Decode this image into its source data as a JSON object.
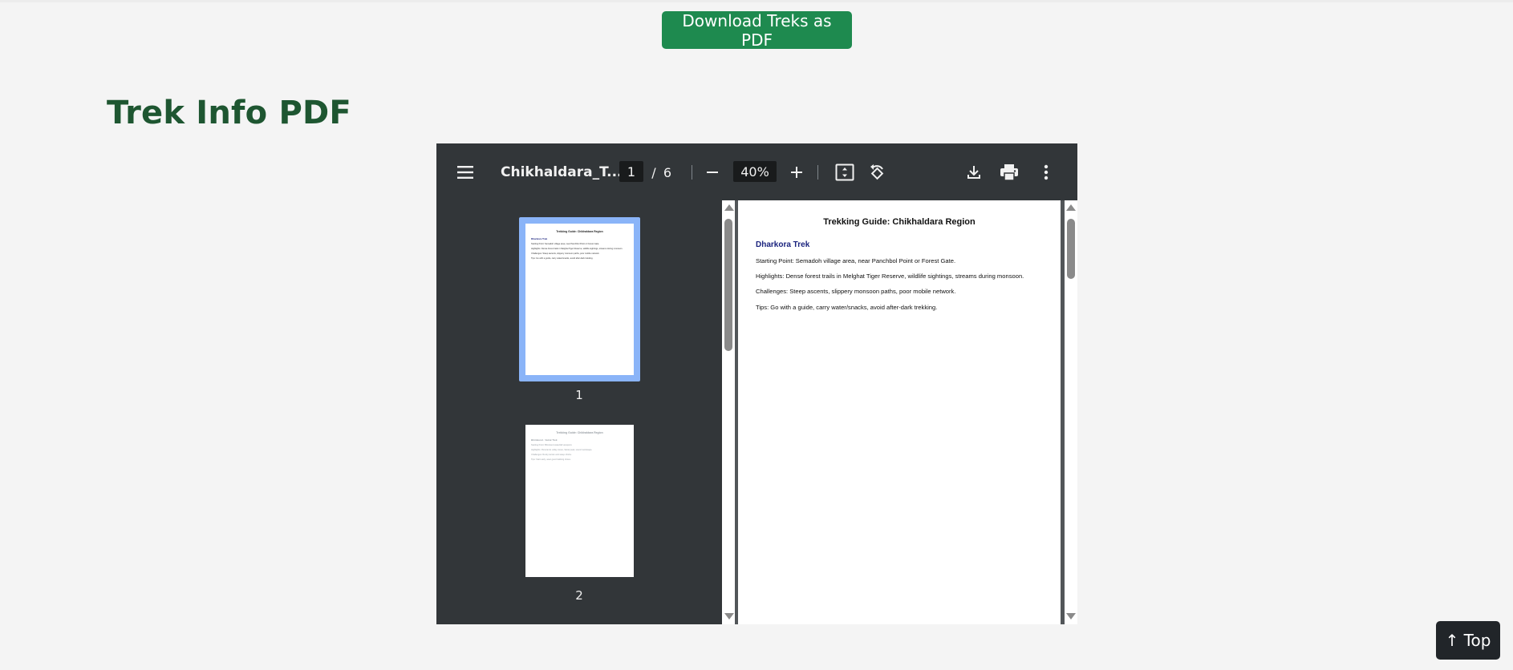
{
  "download_button": {
    "label": "Download Treks as PDF",
    "color": "#1e8a4f"
  },
  "section": {
    "title": "Trek Info PDF",
    "title_color": "#1e5631"
  },
  "pdf_viewer": {
    "toolbar": {
      "document_title": "Chikhaldara_T...",
      "current_page": "1",
      "page_separator": "/",
      "total_pages": "6",
      "zoom": "40%",
      "icons": [
        "menu-icon",
        "zoom-out-icon",
        "zoom-in-icon",
        "fit-to-page-icon",
        "rotate-icon",
        "download-icon",
        "print-icon",
        "more-options-icon"
      ]
    },
    "thumbnails": [
      {
        "number": "1",
        "selected": true,
        "title": "Trekking Guide: Chikhaldara Region",
        "heading": "Dharkora Trek",
        "lines": [
          "Starting Point: Semadoh village area, near Panchbol Point or Forest Gate.",
          "Highlights: Dense forest trails in Melghat Tiger Reserve, wildlife sightings, streams during monsoon.",
          "Challenges: Steep ascents, slippery monsoon paths, poor mobile network.",
          "Tips: Go with a guide, carry water/snacks, avoid after-dark trekking."
        ]
      },
      {
        "number": "2",
        "selected": false,
        "title": "Trekking Guide: Chikhaldara Region",
        "heading": "Bhimkund - Vairat Trek",
        "lines": [
          "Starting Point: Bhimkund waterfall viewpoint.",
          "Highlights: Panoramic valley views, Vairat peak, scenic landscape.",
          "Challenges: Rocky terrain and steep climbs.",
          "Tips: Start early, wear good trekking shoes."
        ]
      }
    ],
    "page": {
      "title": "Trekking Guide: Chikhaldara Region",
      "heading": "Dharkora Trek",
      "lines": [
        "Starting Point: Semadoh village area, near Panchbol Point or Forest Gate.",
        "Highlights: Dense forest trails in Melghat Tiger Reserve, wildlife sightings, streams during monsoon.",
        "Challenges: Steep ascents, slippery monsoon paths, poor mobile network.",
        "Tips: Go with a guide, carry water/snacks, avoid after-dark trekking."
      ]
    }
  },
  "top_button": {
    "label": "↑ Top"
  }
}
